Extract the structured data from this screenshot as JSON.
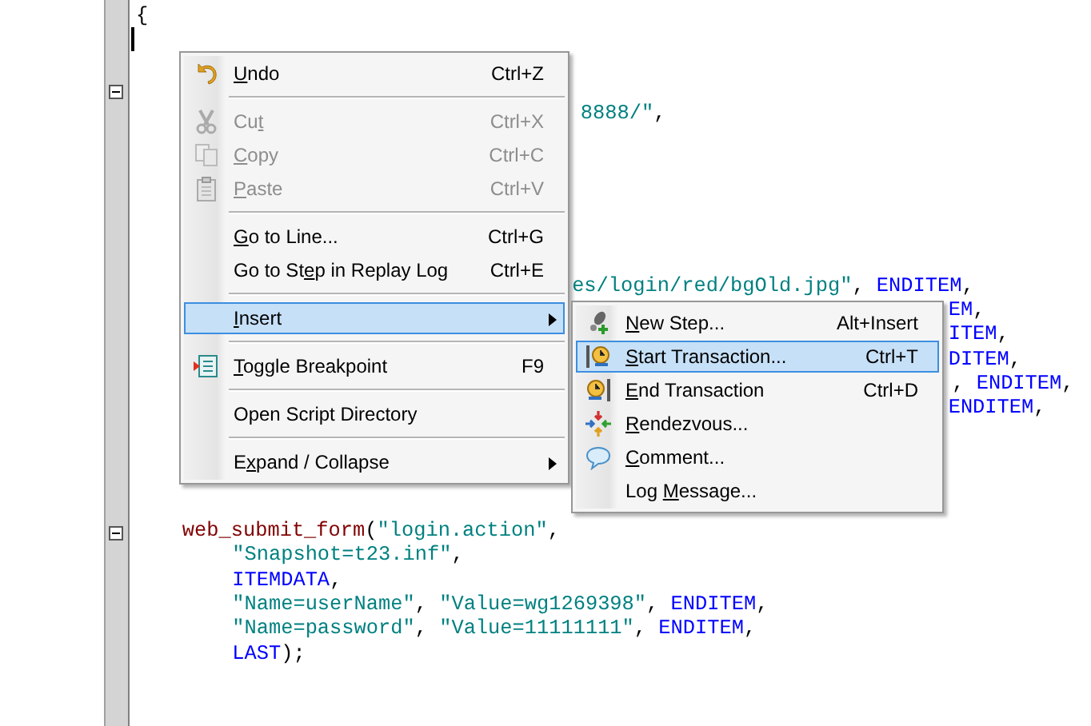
{
  "editor": {
    "lines": [
      {
        "kind": "code",
        "segments": [
          {
            "kind": "punct",
            "text": "{"
          }
        ]
      },
      {
        "kind": "blank",
        "caret": true
      },
      {
        "kind": "blank"
      },
      {
        "kind": "blank",
        "expanded": true
      },
      {
        "kind": "code",
        "segments": [
          {
            "kind": "string",
            "text": "8888/\""
          },
          {
            "kind": "punct",
            "text": ","
          }
        ]
      },
      {
        "kind": "blank"
      },
      {
        "kind": "blank"
      },
      {
        "kind": "blank"
      },
      {
        "kind": "blank"
      },
      {
        "kind": "blank"
      },
      {
        "kind": "blank"
      },
      {
        "kind": "code",
        "segments": [
          {
            "kind": "string",
            "text": "es/login/red/bgOld.jpg\""
          },
          {
            "kind": "punct",
            "text": ", "
          },
          {
            "kind": "keyword",
            "text": "ENDITEM"
          },
          {
            "kind": "punct",
            "text": ","
          }
        ]
      },
      {
        "kind": "code",
        "segments": [
          {
            "kind": "keyword",
            "text": "EM"
          },
          {
            "kind": "punct",
            "text": ","
          }
        ]
      },
      {
        "kind": "code",
        "segments": [
          {
            "kind": "keyword",
            "text": "ITEM"
          },
          {
            "kind": "punct",
            "text": ","
          }
        ]
      },
      {
        "kind": "code",
        "segments": [
          {
            "kind": "keyword",
            "text": "DITEM"
          },
          {
            "kind": "punct",
            "text": ","
          }
        ]
      },
      {
        "kind": "code",
        "segments": [
          {
            "kind": "punct",
            "text": ", "
          },
          {
            "kind": "keyword",
            "text": "ENDITEM"
          },
          {
            "kind": "punct",
            "text": ","
          }
        ]
      },
      {
        "kind": "code",
        "segments": [
          {
            "kind": "keyword",
            "text": "ENDITEM"
          },
          {
            "kind": "punct",
            "text": ","
          }
        ]
      },
      {
        "kind": "blank"
      },
      {
        "kind": "blank"
      },
      {
        "kind": "blank"
      },
      {
        "kind": "blank"
      },
      {
        "kind": "code",
        "expanded": true,
        "segments": [
          {
            "kind": "func",
            "text": "web_submit_form"
          },
          {
            "kind": "punct",
            "text": "("
          },
          {
            "kind": "string",
            "text": "\"login.action\""
          },
          {
            "kind": "punct",
            "text": ","
          }
        ]
      },
      {
        "kind": "code",
        "segments": [
          {
            "kind": "string",
            "text": "\"Snapshot=t23.inf\""
          },
          {
            "kind": "punct",
            "text": ","
          }
        ]
      },
      {
        "kind": "code",
        "segments": [
          {
            "kind": "keyword",
            "text": "ITEMDATA"
          },
          {
            "kind": "punct",
            "text": ","
          }
        ]
      },
      {
        "kind": "code",
        "segments": [
          {
            "kind": "string",
            "text": "\"Name=userName\""
          },
          {
            "kind": "punct",
            "text": ", "
          },
          {
            "kind": "string",
            "text": "\"Value=wg1269398\""
          },
          {
            "kind": "punct",
            "text": ", "
          },
          {
            "kind": "keyword",
            "text": "ENDITEM"
          },
          {
            "kind": "punct",
            "text": ","
          }
        ]
      },
      {
        "kind": "code",
        "segments": [
          {
            "kind": "string",
            "text": "\"Name=password\""
          },
          {
            "kind": "punct",
            "text": ", "
          },
          {
            "kind": "string",
            "text": "\"Value=11111111\""
          },
          {
            "kind": "punct",
            "text": ", "
          },
          {
            "kind": "keyword",
            "text": "ENDITEM"
          },
          {
            "kind": "punct",
            "text": ","
          }
        ]
      },
      {
        "kind": "code",
        "segments": [
          {
            "kind": "keyword",
            "text": "LAST"
          },
          {
            "kind": "punct",
            "text": ");"
          }
        ]
      }
    ]
  },
  "context_menu": {
    "items": [
      {
        "kind": "item",
        "key": "U",
        "post": "ndo",
        "shortcut": "Ctrl+Z",
        "disabled": false,
        "selected": false,
        "submenu": false
      },
      {
        "kind": "separator"
      },
      {
        "kind": "item",
        "pre": "Cu",
        "key": "t",
        "shortcut": "Ctrl+X",
        "disabled": true,
        "selected": false,
        "submenu": false
      },
      {
        "kind": "item",
        "key": "C",
        "post": "opy",
        "shortcut": "Ctrl+C",
        "disabled": true,
        "selected": false,
        "submenu": false
      },
      {
        "kind": "item",
        "key": "P",
        "post": "aste",
        "shortcut": "Ctrl+V",
        "disabled": true,
        "selected": false,
        "submenu": false
      },
      {
        "kind": "separator"
      },
      {
        "kind": "item",
        "key": "G",
        "post": "o to Line...",
        "shortcut": "Ctrl+G",
        "disabled": false,
        "selected": false,
        "submenu": false
      },
      {
        "kind": "item",
        "pre": "Go to St",
        "key": "e",
        "post": "p in Replay Log",
        "shortcut": "Ctrl+E",
        "disabled": false,
        "selected": false,
        "submenu": false
      },
      {
        "kind": "separator"
      },
      {
        "kind": "item",
        "key": "I",
        "post": "nsert",
        "disabled": false,
        "selected": true,
        "submenu": true
      },
      {
        "kind": "separator"
      },
      {
        "kind": "item",
        "key": "T",
        "post": "oggle Breakpoint",
        "shortcut": "F9",
        "disabled": false,
        "selected": false,
        "submenu": false
      },
      {
        "kind": "separator"
      },
      {
        "kind": "item",
        "post": "Open Script Directory",
        "disabled": false,
        "selected": false,
        "submenu": false
      },
      {
        "kind": "separator"
      },
      {
        "kind": "item",
        "pre": "E",
        "key": "x",
        "post": "pand / Collapse",
        "disabled": false,
        "selected": false,
        "submenu": true
      }
    ]
  },
  "insert_submenu": {
    "items": [
      {
        "kind": "item",
        "key": "N",
        "post": "ew Step...",
        "shortcut": "Alt+Insert",
        "disabled": false,
        "selected": false,
        "submenu": false
      },
      {
        "kind": "item",
        "key": "S",
        "post": "tart Transaction...",
        "shortcut": "Ctrl+T",
        "disabled": false,
        "selected": true,
        "submenu": false
      },
      {
        "kind": "item",
        "key": "E",
        "post": "nd Transaction",
        "shortcut": "Ctrl+D",
        "disabled": false,
        "selected": false,
        "submenu": false
      },
      {
        "kind": "item",
        "key": "R",
        "post": "endezvous...",
        "disabled": false,
        "selected": false,
        "submenu": false
      },
      {
        "kind": "item",
        "key": "C",
        "post": "omment...",
        "disabled": false,
        "selected": false,
        "submenu": false
      },
      {
        "kind": "item",
        "pre": "Log ",
        "key": "M",
        "post": "essage...",
        "disabled": false,
        "selected": false,
        "submenu": false
      }
    ]
  }
}
